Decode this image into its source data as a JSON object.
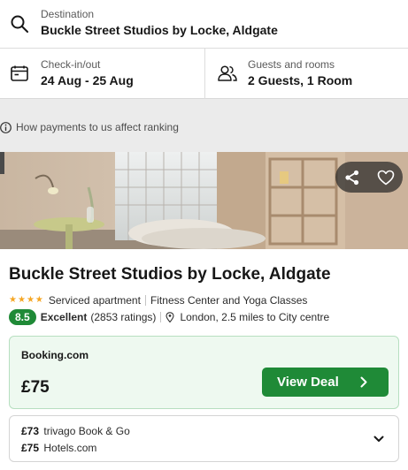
{
  "search": {
    "destination_label": "Destination",
    "destination_value": "Buckle Street Studios by Locke, Aldgate",
    "checkin_label": "Check-in/out",
    "checkin_value": "24 Aug - 25 Aug",
    "guests_label": "Guests and rooms",
    "guests_value": "2 Guests, 1 Room"
  },
  "ranking_info": "How payments to us affect ranking",
  "hotel": {
    "name": "Buckle Street Studios by Locke, Aldgate",
    "stars": 4,
    "type": "Serviced apartment",
    "amenity": "Fitness Center and Yoga Classes",
    "score": "8.5",
    "rating_word": "Excellent",
    "rating_count": "(2853 ratings)",
    "location": "London, 2.5 miles to City centre",
    "deal": {
      "provider": "Booking.com",
      "price": "£75",
      "button_label": "View Deal"
    },
    "alternatives": [
      {
        "price": "£73",
        "provider": "trivago Book & Go"
      },
      {
        "price": "£75",
        "provider": "Hotels.com"
      }
    ]
  },
  "colors": {
    "accent_green": "#1f8a37",
    "star": "#f5a623",
    "deal_bg": "#eef9f0"
  }
}
